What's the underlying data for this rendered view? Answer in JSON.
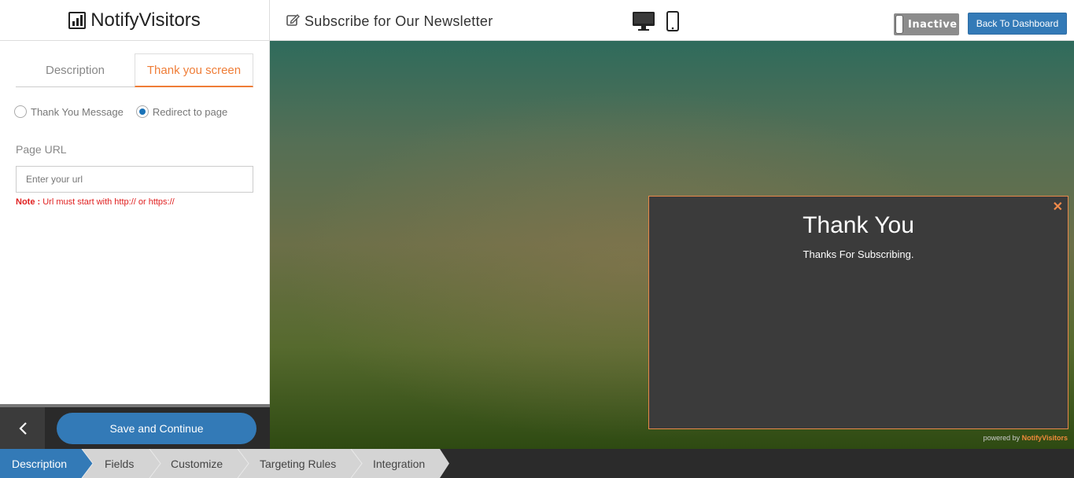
{
  "app": {
    "logo_text": "NotifyVisitors"
  },
  "header": {
    "page_title": "Subscribe for Our Newsletter",
    "status_toggle_label": "Inactive",
    "back_button_label": "Back To Dashboard"
  },
  "left_panel": {
    "tabs": [
      {
        "label": "Description",
        "active": false
      },
      {
        "label": "Thank you screen",
        "active": true
      }
    ],
    "radio_options": [
      {
        "label": "Thank You Message",
        "checked": false
      },
      {
        "label": "Redirect to page",
        "checked": true
      }
    ],
    "page_url_label": "Page URL",
    "url_placeholder": "Enter your url",
    "note_prefix": "Note :",
    "note_text": " Url must start with http:// or https://"
  },
  "footer": {
    "save_button_label": "Save and Continue"
  },
  "preview": {
    "modal_title": "Thank You",
    "modal_subtitle": "Thanks For Subscribing.",
    "powered_by_prefix": "powered by ",
    "powered_by_brand": "NotifyVisitors"
  },
  "steps": [
    {
      "label": "Description",
      "active": true
    },
    {
      "label": "Fields",
      "active": false
    },
    {
      "label": "Customize",
      "active": false
    },
    {
      "label": "Targeting Rules",
      "active": false
    },
    {
      "label": "Integration",
      "active": false
    }
  ],
  "colors": {
    "accent_orange": "#ef7d37",
    "primary_blue": "#337ab7",
    "note_red": "#e02020",
    "step_active": "#337ab7",
    "step_inactive": "#d9d9d9"
  }
}
